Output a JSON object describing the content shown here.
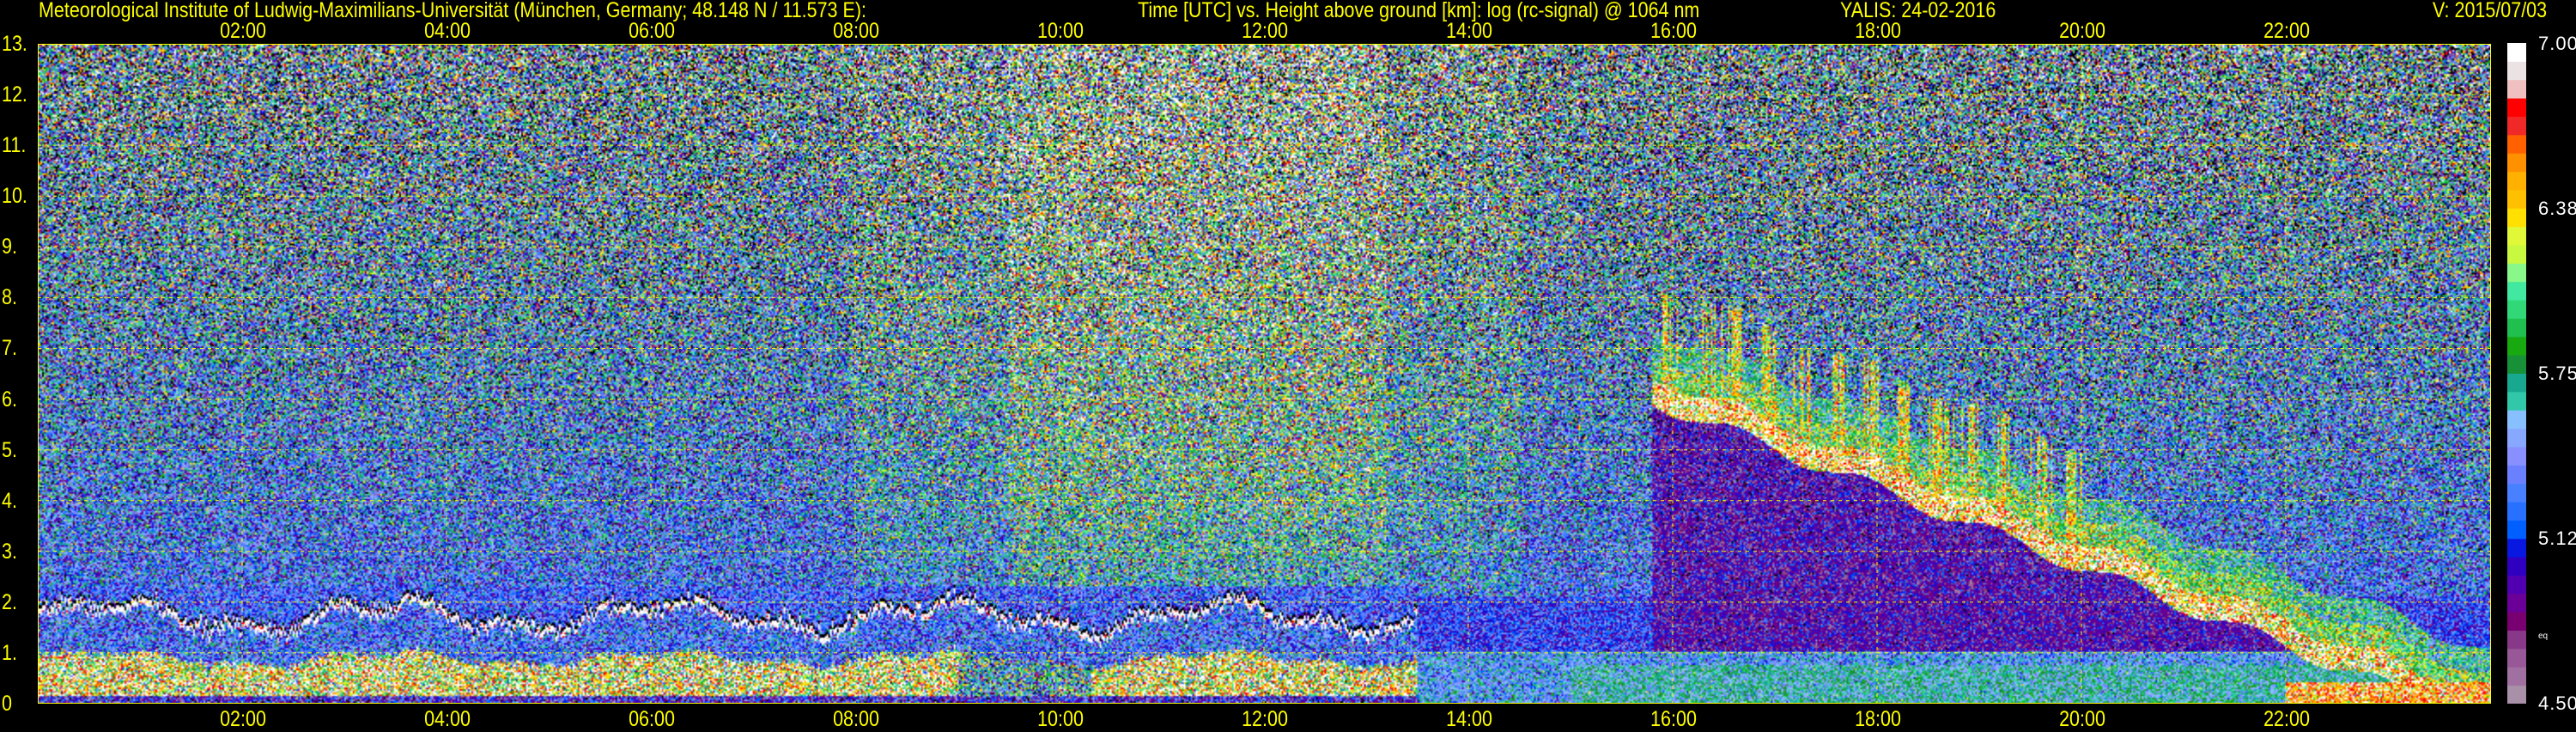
{
  "header": {
    "institute": "Meteorological Institute of Ludwig-Maximilians-Universität (München, Germany; 48.148 N / 11.573 E):",
    "axes_description": "Time [UTC] vs. Height above ground [km]: log (rc-signal) @ 1064 nm",
    "instrument_date": "YALIS: 24-02-2016",
    "version": "V: 2015/07/03"
  },
  "chart_data": {
    "type": "heatmap",
    "title": "Time [UTC] vs. Height above ground [km]: log (rc-signal) @ 1064 nm",
    "xlabel": "Time [UTC]",
    "ylabel": "Height above ground [km]",
    "xlim": [
      0,
      24
    ],
    "ylim": [
      0,
      13
    ],
    "x_ticks": [
      "02:00",
      "04:00",
      "06:00",
      "08:00",
      "10:00",
      "12:00",
      "14:00",
      "16:00",
      "18:00",
      "20:00",
      "22:00"
    ],
    "y_ticks": [
      "0",
      "1.",
      "2.",
      "3.",
      "4.",
      "5.",
      "6.",
      "7.",
      "8.",
      "9.",
      "10.",
      "11.",
      "12.",
      "13."
    ],
    "grid": true,
    "colorbar": {
      "range": [
        4.5,
        7.0
      ],
      "labels": [
        "7.00",
        "6.38",
        "5.75",
        "5.12",
        "4.50"
      ],
      "note": "eq",
      "colors": [
        "#a890a8",
        "#a070a0",
        "#985898",
        "#883888",
        "#780070",
        "#6a0098",
        "#5000b0",
        "#3000c0",
        "#0818e0",
        "#0060ff",
        "#2870ff",
        "#4880ff",
        "#6a80ff",
        "#8890ff",
        "#88a8ff",
        "#88c0ff",
        "#30c8a8",
        "#18a890",
        "#189038",
        "#18a810",
        "#20c050",
        "#30d878",
        "#40e8a0",
        "#88f888",
        "#c8f840",
        "#e0f838",
        "#ffe000",
        "#ffc000",
        "#ffb000",
        "#ff9000",
        "#ff6000",
        "#f02828",
        "#ff0000",
        "#f0c0c0",
        "#ebe3e3",
        "#ffffff"
      ]
    },
    "features": [
      {
        "name": "boundary layer top with clouds",
        "time": [
          0,
          13.5
        ],
        "height_km": [
          1.5,
          2.1
        ]
      },
      {
        "name": "descending cloud band",
        "time": [
          16,
          24
        ],
        "height_km_start": 6.0,
        "height_km_end": 0.4
      },
      {
        "name": "residual/lower aerosol layer",
        "time": [
          13.5,
          24
        ],
        "height_km": [
          0,
          1.0
        ]
      }
    ]
  }
}
